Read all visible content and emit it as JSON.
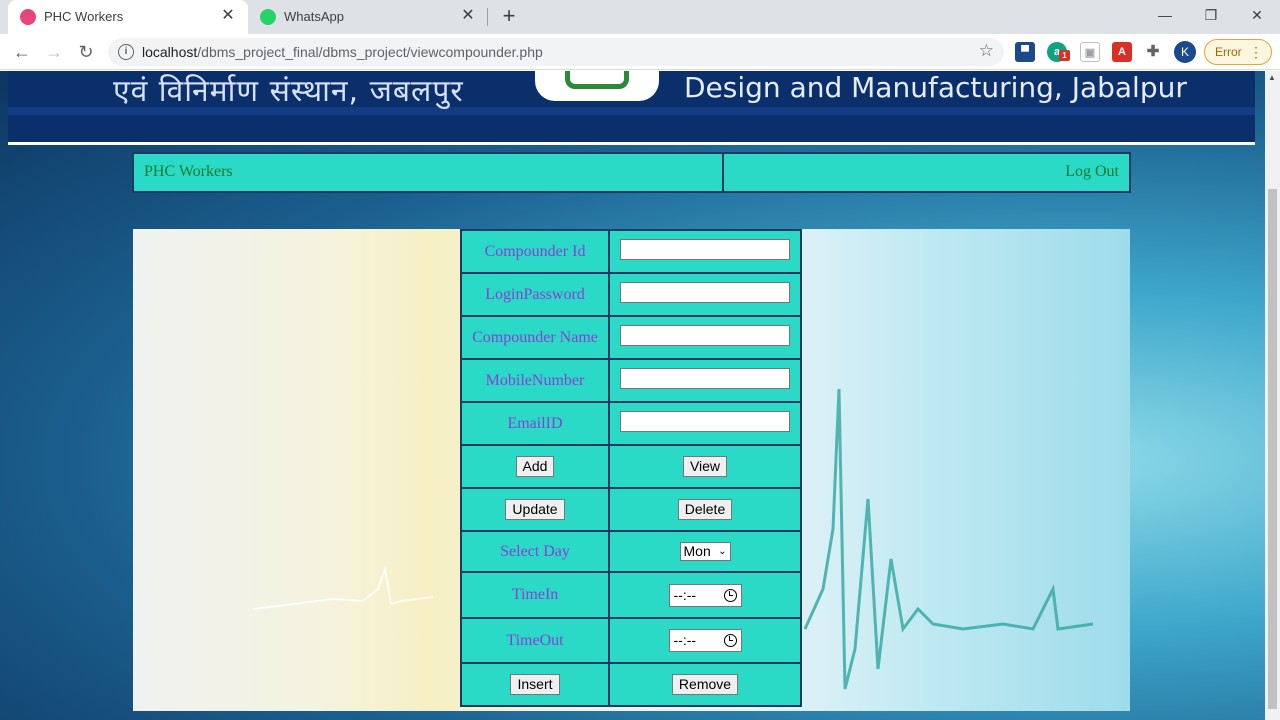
{
  "browser": {
    "tabs": [
      {
        "title": "PHC Workers",
        "active": true,
        "favicon": "wamp-icon",
        "color": "#e8457c"
      },
      {
        "title": "WhatsApp",
        "active": false,
        "favicon": "whatsapp-icon",
        "color": "#25d366"
      }
    ],
    "url_host": "localhost",
    "url_path": "/dbms_project_final/dbms_project/viewcompounder.php",
    "extension_badge": "1",
    "profile_initial": "K",
    "error_label": "Error"
  },
  "banner": {
    "hindi_text": "एवं विनिर्माण संस्थान, जबलपुर",
    "english_text": "Design and Manufacturing, Jabalpur"
  },
  "header": {
    "title": "PHC Workers",
    "logout": "Log Out"
  },
  "form": {
    "fields": [
      {
        "label": "Compounder Id",
        "value": ""
      },
      {
        "label": "LoginPassword",
        "value": ""
      },
      {
        "label": "Compounder Name",
        "value": ""
      },
      {
        "label": "MobileNumber",
        "value": ""
      },
      {
        "label": "EmailID",
        "value": ""
      }
    ],
    "buttons": {
      "add": "Add",
      "view": "View",
      "update": "Update",
      "delete": "Delete",
      "insert": "Insert",
      "remove": "Remove"
    },
    "select_day_label": "Select Day",
    "select_day_value": "Mon",
    "time_in_label": "TimeIn",
    "time_in_value": "--:--",
    "time_out_label": "TimeOut",
    "time_out_value": "--:--"
  },
  "colors": {
    "cell_bg": "#2bd9c7",
    "label_text": "#8a3fd6",
    "header_text": "#1a7a2e",
    "border": "#1d3a63"
  }
}
